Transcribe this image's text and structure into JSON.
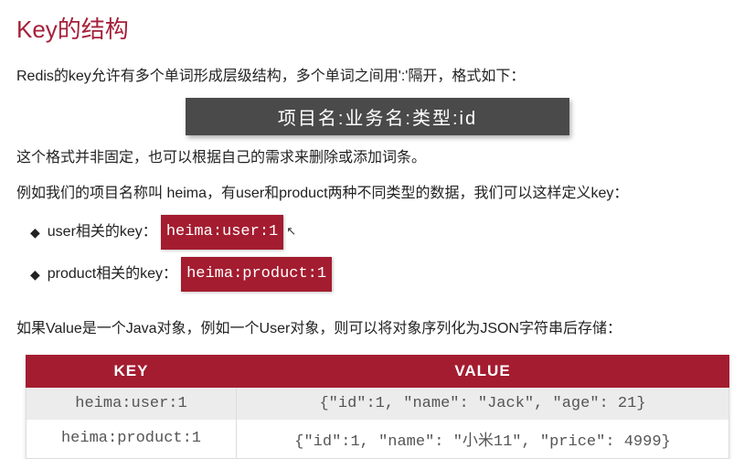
{
  "title": "Key的结构",
  "intro": "Redis的key允许有多个单词形成层级结构，多个单词之间用':'隔开，格式如下：",
  "format_box": "项目名:业务名:类型:id",
  "para2": "这个格式并非固定，也可以根据自己的需求来删除或添加词条。",
  "para3": "例如我们的项目名称叫 heima，有user和product两种不同类型的数据，我们可以这样定义key：",
  "bullets": [
    {
      "label": "user相关的key：",
      "code": "heima:user:1",
      "cursor": true
    },
    {
      "label": "product相关的key：",
      "code": "heima:product:1",
      "cursor": false
    }
  ],
  "para4": "如果Value是一个Java对象，例如一个User对象，则可以将对象序列化为JSON字符串后存储：",
  "table": {
    "headers": [
      "KEY",
      "VALUE"
    ],
    "rows": [
      {
        "key": "heima:user:1",
        "value": "{\"id\":1, \"name\": \"Jack\", \"age\": 21}"
      },
      {
        "key": "heima:product:1",
        "value": "{\"id\":1, \"name\": \"小米11\", \"price\": 4999}"
      }
    ]
  }
}
